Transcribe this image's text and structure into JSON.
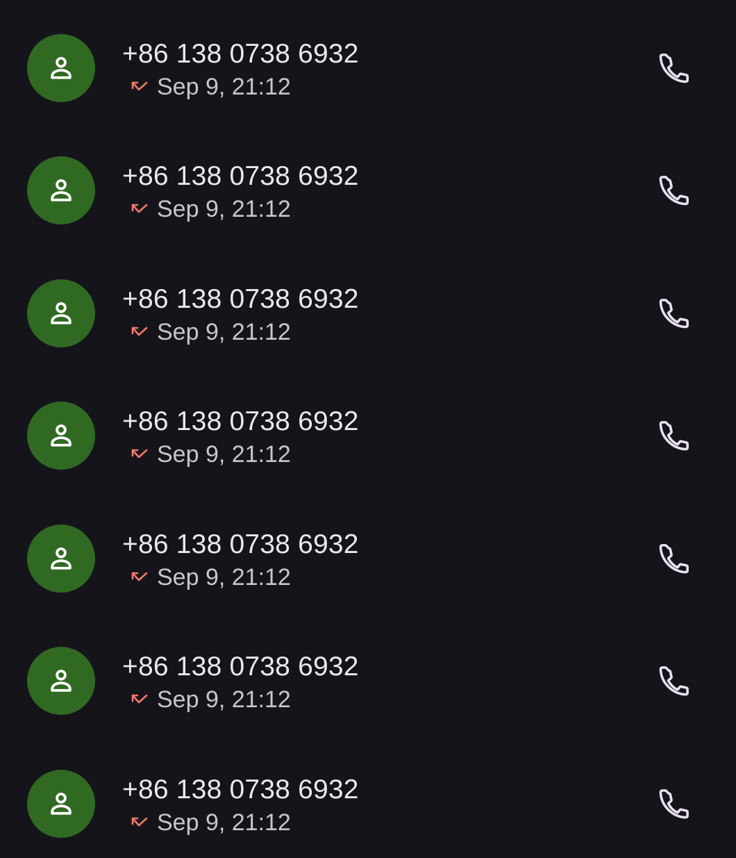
{
  "colors": {
    "background": "#16141b",
    "avatar": "#306a22",
    "number_text": "#ebe7ef",
    "meta_text": "#cac5cd",
    "missed": "#f07a6a"
  },
  "icons": {
    "avatar": "person-icon",
    "status": "missed-call-icon",
    "action": "phone-icon"
  },
  "calls": [
    {
      "number": "+86 138 0738 6932",
      "time": "Sep 9, 21:12",
      "status": "missed"
    },
    {
      "number": "+86 138 0738 6932",
      "time": "Sep 9, 21:12",
      "status": "missed"
    },
    {
      "number": "+86 138 0738 6932",
      "time": "Sep 9, 21:12",
      "status": "missed"
    },
    {
      "number": "+86 138 0738 6932",
      "time": "Sep 9, 21:12",
      "status": "missed"
    },
    {
      "number": "+86 138 0738 6932",
      "time": "Sep 9, 21:12",
      "status": "missed"
    },
    {
      "number": "+86 138 0738 6932",
      "time": "Sep 9, 21:12",
      "status": "missed"
    },
    {
      "number": "+86 138 0738 6932",
      "time": "Sep 9, 21:12",
      "status": "missed"
    }
  ]
}
